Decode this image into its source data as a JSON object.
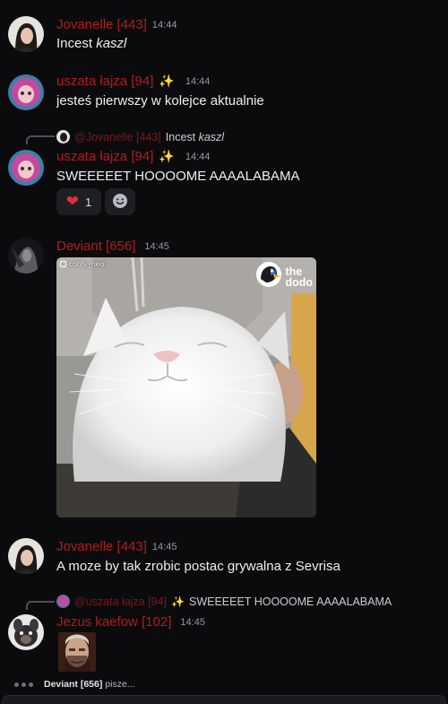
{
  "messages": [
    {
      "author": "Jovanelle [443]",
      "time": "14:44",
      "text_plain": "Incest ",
      "text_italic": "kaszl"
    },
    {
      "author": "uszata łajza [94]",
      "sparkle": "✨",
      "time": "14:44",
      "text": "jesteś pierwszy w kolejce aktualnie"
    },
    {
      "reply": {
        "author": "@Jovanelle [443]",
        "text_plain": "Incest ",
        "text_italic": "kaszl"
      },
      "author": "uszata łajza [94]",
      "sparkle": "✨",
      "time": "14:44",
      "text": "SWEEEEET HOOOOME AAAALABAMA",
      "reactions": [
        {
          "emoji": "❤",
          "count": "1"
        }
      ]
    },
    {
      "author": "Deviant [656]",
      "time": "14:45",
      "image": {
        "watermark_user": "cohty_neo",
        "brand_line1": "the",
        "brand_line2": "dodo"
      }
    },
    {
      "author": "Jovanelle [443]",
      "time": "14:45",
      "text": "A moze by tak zrobic postac grywalna z Sevrisa"
    },
    {
      "reply": {
        "author": "@uszata łajza [94]",
        "sparkle": "✨",
        "text": "SWEEEEET HOOOOME AAAALABAMA"
      },
      "author": "Jezus kaefow [102]",
      "time": "14:45"
    }
  ],
  "typing": {
    "user": "Deviant [656]",
    "suffix": " pisze..."
  },
  "colors": {
    "name": "#b31b1b",
    "background": "#0b0b0d",
    "time": "#949ba4"
  }
}
